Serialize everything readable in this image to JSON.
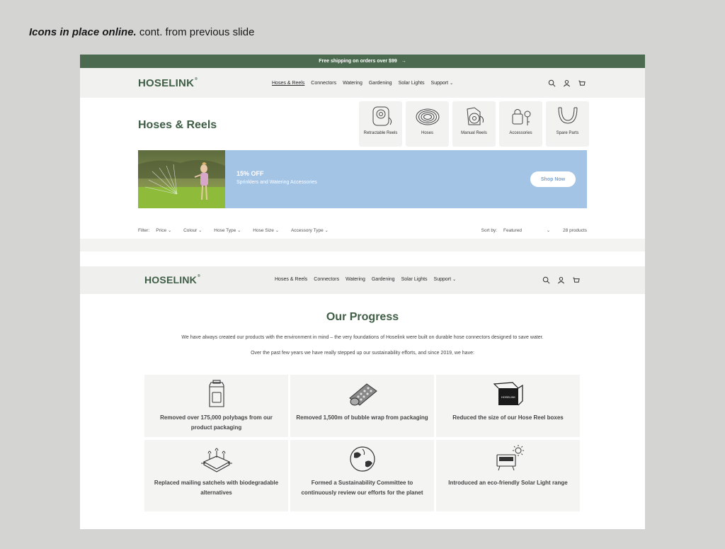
{
  "caption": {
    "bold": "Icons in place online.",
    "rest": "cont. from previous slide"
  },
  "announcement": {
    "text": "Free shipping on orders over $99",
    "arrow": "→"
  },
  "brand": {
    "name": "HOSELINK",
    "mark": "®",
    "color": "#3f5e45"
  },
  "nav": {
    "items": [
      {
        "label": "Hoses & Reels"
      },
      {
        "label": "Connectors"
      },
      {
        "label": "Watering"
      },
      {
        "label": "Gardening"
      },
      {
        "label": "Solar Lights"
      },
      {
        "label": "Support"
      }
    ],
    "chevron": "⌄"
  },
  "collection": {
    "title": "Hoses & Reels",
    "categories": [
      {
        "label": "Retractable Reels",
        "icon": "retractable-reel-icon"
      },
      {
        "label": "Hoses",
        "icon": "hose-coil-icon"
      },
      {
        "label": "Manual Reels",
        "icon": "manual-reel-icon"
      },
      {
        "label": "Accessories",
        "icon": "accessories-icon"
      },
      {
        "label": "Spare Parts",
        "icon": "spare-part-icon"
      }
    ]
  },
  "promo": {
    "title": "15% OFF",
    "subtitle": "Sprinklers and Watering Accessories",
    "button": "Shop Now",
    "bg_color": "#a4c4e6"
  },
  "filters": {
    "label": "Filter:",
    "items": [
      "Price",
      "Colour",
      "Hose Type",
      "Hose Size",
      "Accessory Type"
    ],
    "sort_label": "Sort by:",
    "sort_value": "Featured",
    "count": "28 products"
  },
  "progress": {
    "title": "Our Progress",
    "para1": "We have always created our products with the environment in mind – the very foundations of Hoselink were built on durable hose connectors designed to save water.",
    "para2": "Over the past few years we have really stepped up our sustainability efforts, and since 2019, we have:",
    "cards": [
      {
        "text": "Removed over 175,000 polybags from our product packaging",
        "icon": "polybag-icon"
      },
      {
        "text": "Removed 1,500m of bubble wrap from packaging",
        "icon": "bubble-wrap-icon"
      },
      {
        "text": "Reduced the size of our Hose Reel boxes",
        "icon": "box-icon"
      },
      {
        "text": "Replaced mailing satchels with biodegradable alternatives",
        "icon": "compost-satchel-icon"
      },
      {
        "text": "Formed a Sustainability Committee to continuously review our efforts for the planet",
        "icon": "globe-icon"
      },
      {
        "text": "Introduced an eco-friendly Solar Light range",
        "icon": "solar-light-icon"
      }
    ]
  },
  "colors": {
    "announcement_bg": "#4b6a4f",
    "nav_bg": "#f1f1f0",
    "tile_bg": "#f2f2f1"
  }
}
